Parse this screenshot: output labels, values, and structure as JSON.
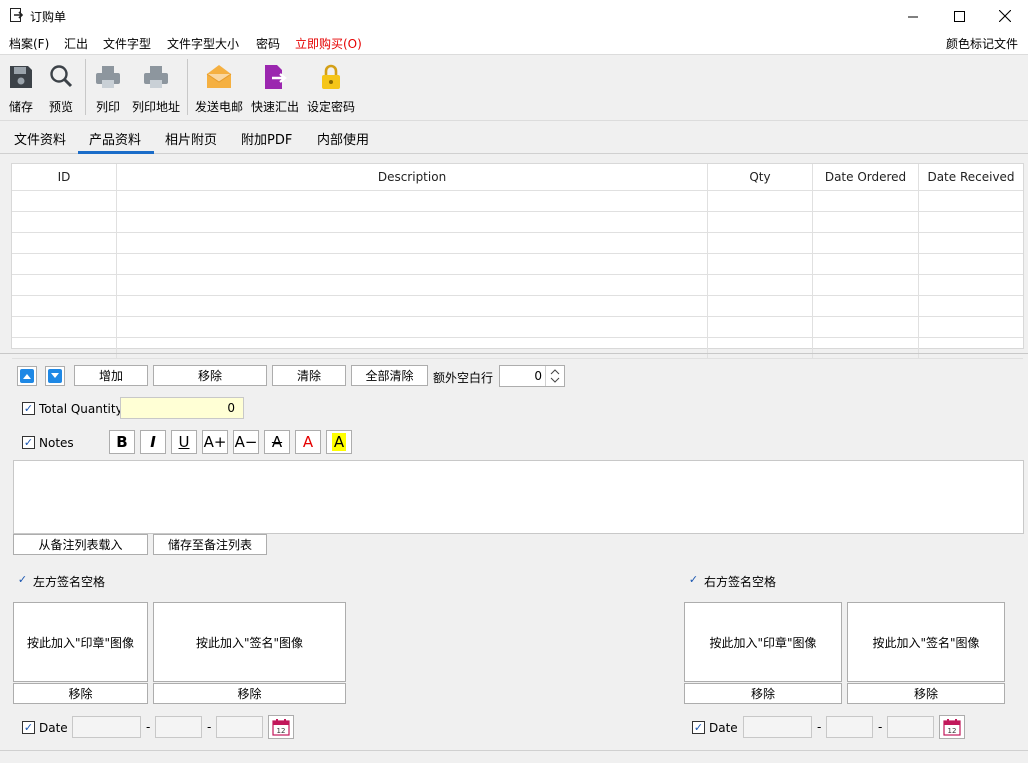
{
  "window": {
    "title": "订购单"
  },
  "menu": {
    "items": [
      "档案(F)",
      "汇出",
      "文件字型",
      "文件字型大小",
      "密码",
      "立即购买(O)"
    ],
    "right": "颜色标记文件"
  },
  "toolbar": {
    "save": "储存",
    "preview": "预览",
    "print": "列印",
    "print_address": "列印地址",
    "send_email": "发送电邮",
    "quick_export": "快速汇出",
    "set_password": "设定密码"
  },
  "tabs": [
    "文件资料",
    "产品资料",
    "相片附页",
    "附加PDF",
    "内部使用"
  ],
  "active_tab": "产品资料",
  "grid": {
    "columns": [
      "ID",
      "Description",
      "Qty",
      "Date Ordered",
      "Date Received"
    ],
    "empty_rows": 8
  },
  "row_controls": {
    "add": "增加",
    "remove": "移除",
    "clear": "清除",
    "clear_all": "全部清除",
    "extra_blank_rows_label": "额外空白行",
    "extra_blank_rows_value": "0"
  },
  "total_quantity": {
    "label": "Total Quantity",
    "value": "0",
    "checked": true
  },
  "notes": {
    "label": "Notes",
    "checked": true,
    "format_buttons": [
      "B",
      "I",
      "U",
      "A+",
      "A−",
      "A",
      "A",
      "A"
    ],
    "load_from_list": "从备注列表载入",
    "save_to_list": "储存至备注列表"
  },
  "signature_left": {
    "label": "左方签名空格",
    "checked": true,
    "stamp_button": "按此加入\"印章\"图像",
    "sign_button": "按此加入\"签名\"图像",
    "remove": "移除",
    "date_label": "Date",
    "date_sep": "-"
  },
  "signature_right": {
    "label": "右方签名空格",
    "checked": true,
    "stamp_button": "按此加入\"印章\"图像",
    "sign_button": "按此加入\"签名\"图像",
    "remove": "移除",
    "date_label": "Date",
    "date_sep": "-"
  },
  "colors": {
    "accent": "#1a6cc8",
    "menu_red": "#e60000",
    "highlight_yellow": "#ffffd5"
  }
}
